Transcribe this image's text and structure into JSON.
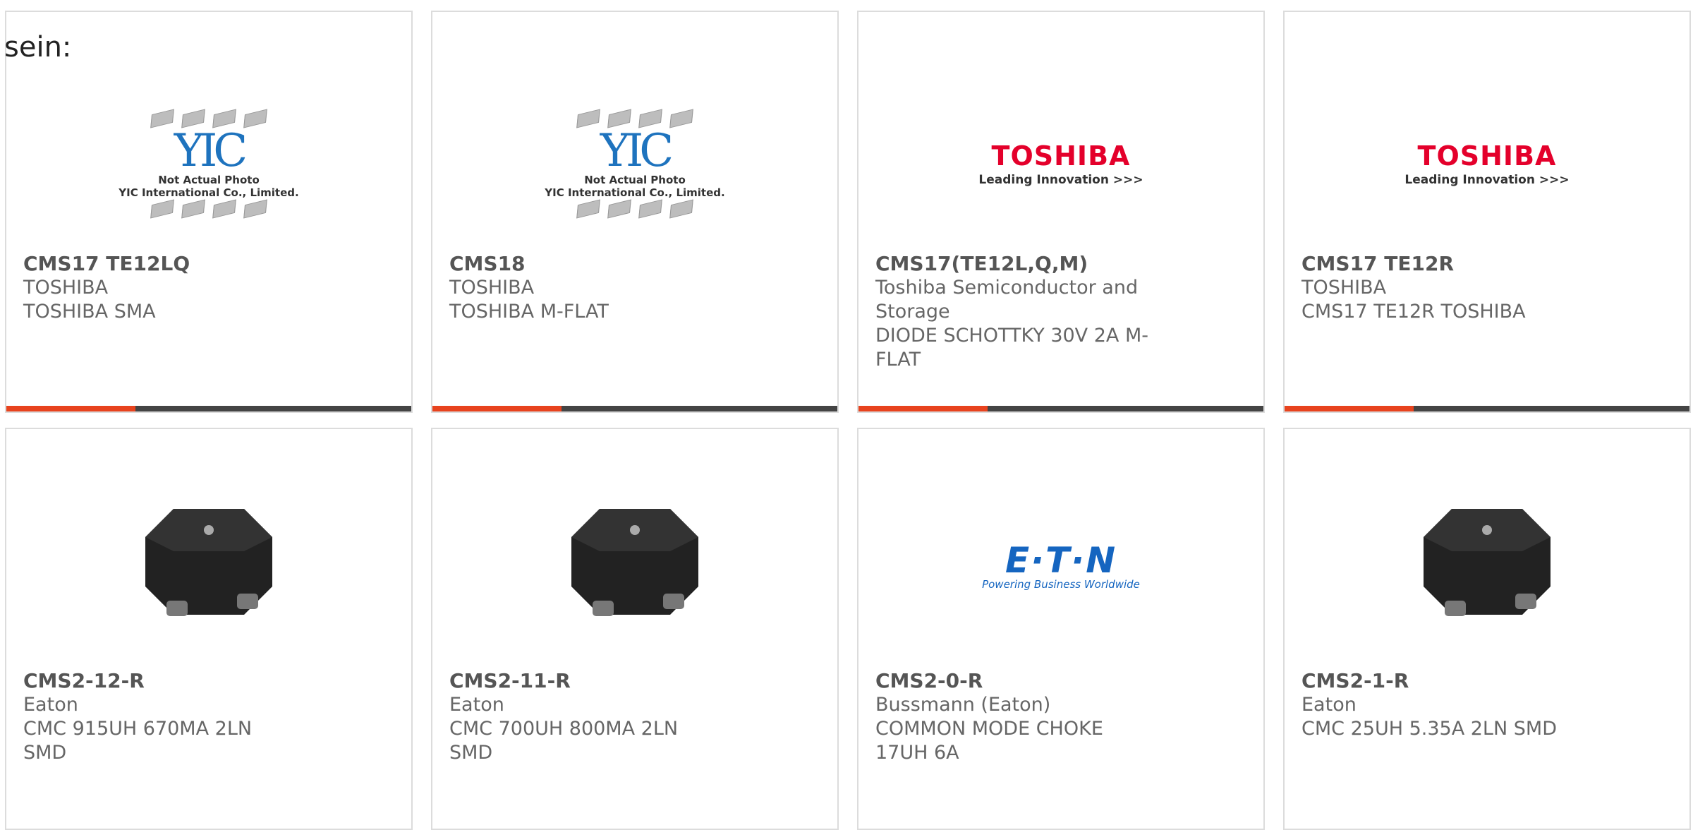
{
  "intro": "sein:",
  "products": [
    {
      "part": "CMS17 TE12LQ",
      "maker": "TOSHIBA",
      "desc": "TOSHIBA SMA",
      "image": "yic-placeholder"
    },
    {
      "part": "CMS18",
      "maker": "TOSHIBA",
      "desc": "TOSHIBA M-FLAT",
      "image": "yic-placeholder"
    },
    {
      "part": "CMS17(TE12L,Q,M)",
      "maker": "Toshiba Semiconductor and Storage",
      "desc": "DIODE SCHOTTKY 30V 2A M-FLAT",
      "image": "toshiba-logo"
    },
    {
      "part": "CMS17 TE12R",
      "maker": "TOSHIBA",
      "desc": "CMS17 TE12R TOSHIBA",
      "image": "toshiba-logo"
    },
    {
      "part": "CMS2-12-R",
      "maker": "Eaton",
      "desc": "CMC 915UH 670MA 2LN SMD",
      "image": "choke-photo"
    },
    {
      "part": "CMS2-11-R",
      "maker": "Eaton",
      "desc": "CMC 700UH 800MA 2LN SMD",
      "image": "choke-photo"
    },
    {
      "part": "CMS2-0-R",
      "maker": "Bussmann (Eaton)",
      "desc": "COMMON MODE CHOKE 17UH 6A",
      "image": "eaton-logo"
    },
    {
      "part": "CMS2-1-R",
      "maker": "Eaton",
      "desc": "CMC 25UH 5.35A 2LN SMD",
      "image": "choke-photo"
    }
  ],
  "logos": {
    "toshiba_name": "TOSHIBA",
    "toshiba_tagline": "Leading Innovation >>>",
    "eaton_name": "E·T·N",
    "eaton_tagline": "Powering Business Worldwide",
    "yic_mark": "YIC",
    "yic_line1": "Not Actual Photo",
    "yic_line2": "YIC International Co., Limited."
  },
  "colors": {
    "accent": "#e8431e",
    "bar": "#444444",
    "toshiba_red": "#e4002b",
    "eaton_blue": "#1565c0"
  }
}
